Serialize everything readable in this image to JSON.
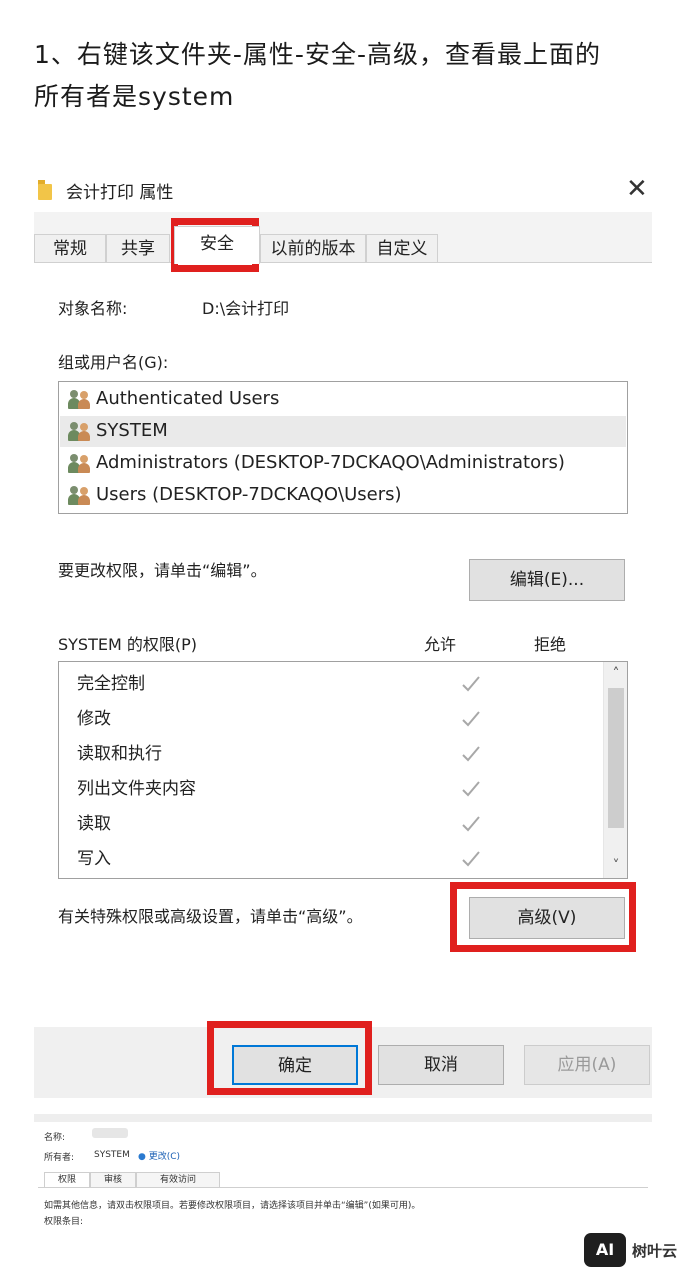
{
  "intro": {
    "line1": "1、右键该文件夹-属性-安全-高级，查看最上面的",
    "line2": "所有者是system"
  },
  "dialog": {
    "title": "会计打印 属性",
    "close_symbol": "✕",
    "tabs": [
      {
        "label": "常规",
        "active": false
      },
      {
        "label": "共享",
        "active": false
      },
      {
        "label": "安全",
        "active": true
      },
      {
        "label": "以前的版本",
        "active": false
      },
      {
        "label": "自定义",
        "active": false
      }
    ],
    "object_name_label": "对象名称:",
    "object_name_value": "D:\\会计打印",
    "groups_label": "组或用户名(G):",
    "users": [
      {
        "name": "Authenticated Users",
        "selected": false,
        "icon": "users-icon"
      },
      {
        "name": "SYSTEM",
        "selected": true,
        "icon": "users-icon"
      },
      {
        "name": "Administrators (DESKTOP-7DCKAQO\\Administrators)",
        "selected": false,
        "icon": "users-icon"
      },
      {
        "name": "Users (DESKTOP-7DCKAQO\\Users)",
        "selected": false,
        "icon": "users-icon"
      }
    ],
    "edit_hint": "要更改权限，请单击“编辑”。",
    "edit_button": "编辑(E)...",
    "perm_header": "SYSTEM 的权限(P)",
    "allow_col": "允许",
    "deny_col": "拒绝",
    "permissions": [
      {
        "name": "完全控制",
        "allow": true,
        "deny": false
      },
      {
        "name": "修改",
        "allow": true,
        "deny": false
      },
      {
        "name": "读取和执行",
        "allow": true,
        "deny": false
      },
      {
        "name": "列出文件夹内容",
        "allow": true,
        "deny": false
      },
      {
        "name": "读取",
        "allow": true,
        "deny": false
      },
      {
        "name": "写入",
        "allow": true,
        "deny": false
      }
    ],
    "advanced_hint": "有关特殊权限或高级设置，请单击“高级”。",
    "advanced_button": "高级(V)",
    "ok_button": "确定",
    "cancel_button": "取消",
    "apply_button": "应用(A)"
  },
  "secondary": {
    "name_label": "名称:",
    "owner_label": "所有者:",
    "owner_value": "SYSTEM",
    "change_link": "更改(C)",
    "tabs": [
      "权限",
      "审核",
      "有效访问"
    ],
    "info_text": "如需其他信息，请双击权限项目。若要修改权限项目，请选择该项目并单击“编辑”(如果可用)。",
    "entries_label": "权限条目:"
  },
  "watermark": {
    "logo_text": "AI",
    "site_text": "树叶云"
  },
  "colors": {
    "highlight": "#e0201e",
    "dialog_bg": "#f0f0f0",
    "check": "#a8a8a8"
  }
}
